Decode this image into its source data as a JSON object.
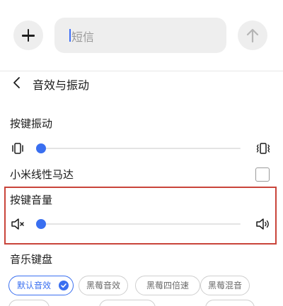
{
  "compose": {
    "placeholder": "短信"
  },
  "settings": {
    "title": "音效与振动",
    "key_vibration": {
      "label": "按键振动",
      "level": 0
    },
    "xiaomi_motor": {
      "label": "小米线性马达",
      "checked": false
    },
    "key_volume": {
      "label": "按键音量",
      "level": 0
    },
    "music_keyboard": {
      "label": "音乐键盘",
      "options": [
        {
          "label": "默认音效",
          "selected": true
        },
        {
          "label": "黑莓音效",
          "selected": false
        },
        {
          "label": "黑莓四倍速",
          "selected": false
        },
        {
          "label": "黑莓混音",
          "selected": false
        }
      ]
    }
  },
  "colors": {
    "accent": "#3a6ff0",
    "highlight_border": "#c9443a"
  }
}
